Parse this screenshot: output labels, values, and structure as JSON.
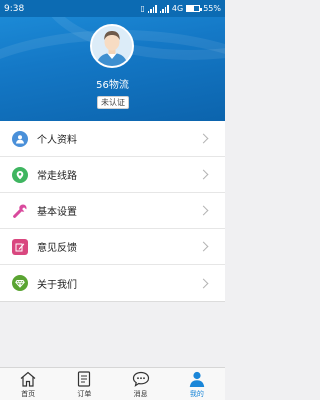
{
  "status_bar": {
    "time": "9:38",
    "network": "4G",
    "battery": "55%"
  },
  "profile": {
    "company_name": "56物流",
    "verify_status": "未认证"
  },
  "menu": [
    {
      "label": "个人资料",
      "icon": "person-icon",
      "color": "#4a90d9"
    },
    {
      "label": "常走线路",
      "icon": "location-pin-icon",
      "color": "#3fb560"
    },
    {
      "label": "基本设置",
      "icon": "wrench-icon",
      "color": "#d94a9d"
    },
    {
      "label": "意见反馈",
      "icon": "edit-icon",
      "color": "#d9477f"
    },
    {
      "label": "关于我们",
      "icon": "diamond-icon",
      "color": "#5aa432"
    }
  ],
  "tabs": [
    {
      "label": "首页",
      "icon": "home-icon",
      "active": false
    },
    {
      "label": "订单",
      "icon": "document-icon",
      "active": false
    },
    {
      "label": "消息",
      "icon": "chat-bubble-icon",
      "active": false
    },
    {
      "label": "我的",
      "icon": "user-icon",
      "active": true
    }
  ],
  "colors": {
    "primary": "#1a86d8",
    "header": "#1478c6"
  }
}
